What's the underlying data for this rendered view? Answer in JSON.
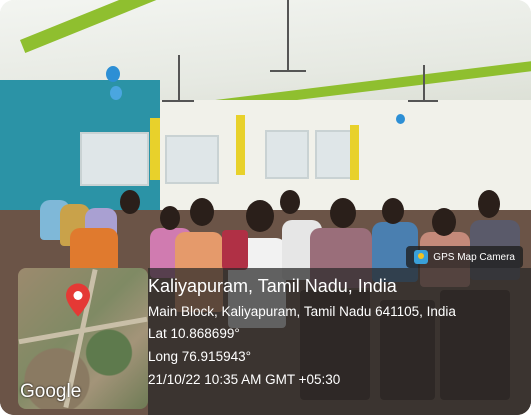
{
  "app": {
    "badge_label": "GPS Map Camera"
  },
  "location": {
    "title": "Kaliyapuram, Tamil Nadu, India",
    "address": "Main Block, Kaliyapuram, Tamil Nadu 641105, India",
    "lat": "Lat 10.868699°",
    "long": "Long 76.915943°",
    "datetime": "21/10/22 10:35 AM GMT +05:30"
  },
  "map": {
    "provider": "Google",
    "pin_color": "#e53935",
    "pin_icon": "map-pin-icon"
  }
}
